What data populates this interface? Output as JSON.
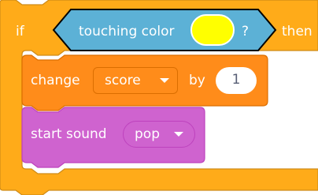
{
  "if_block": {
    "if_label": "if",
    "then_label": "then",
    "color": "#ffab19",
    "border_color": "#cf8b17"
  },
  "condition": {
    "label": "touching color",
    "question_mark": "?",
    "color": "#5cb1d6",
    "border_color": "#000000",
    "swatch_color": "#ffff00"
  },
  "change_block": {
    "label_change": "change",
    "variable": "score",
    "label_by": "by",
    "amount": "1",
    "color": "#ff8c1a",
    "border_color": "#db6e00"
  },
  "sound_block": {
    "label": "start sound",
    "sound": "pop",
    "color": "#cf63cf",
    "border_color": "#bd42bd"
  }
}
